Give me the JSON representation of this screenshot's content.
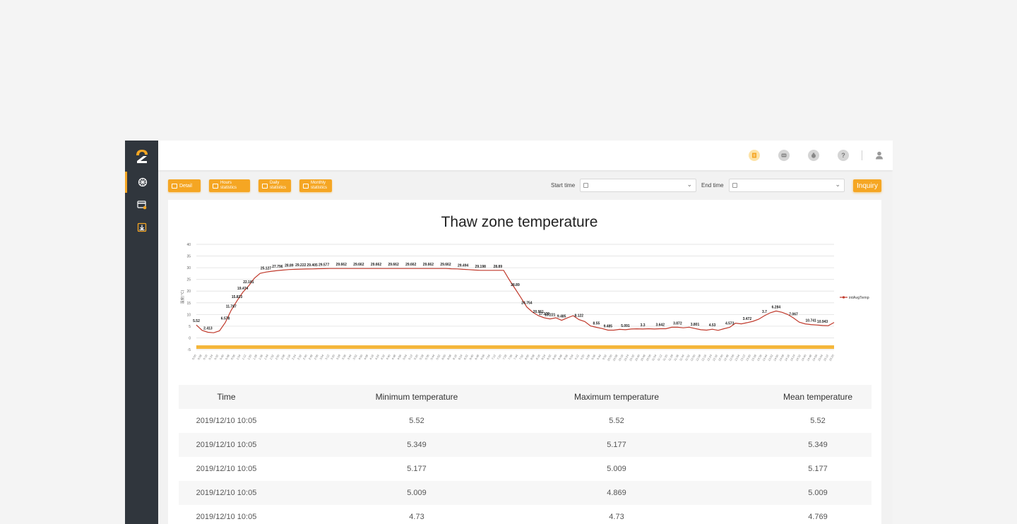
{
  "toolbar": {
    "detail": "Detail",
    "hours": "Hours statistics",
    "daily": "Daily statistics",
    "monthly": "Monthly statistics",
    "start_label": "Start time",
    "end_label": "End time",
    "start_value": "",
    "end_value": "",
    "inquiry": "Inquiry"
  },
  "colors": {
    "accent": "#f5a623",
    "sidebar": "#30363d",
    "line": "#c0392b"
  },
  "sidebar": {
    "items": [
      "dashboard-icon",
      "device-icon",
      "download-icon"
    ]
  },
  "header": {
    "icons": [
      "report-icon",
      "message-icon",
      "money-icon",
      "help-icon",
      "user-icon"
    ]
  },
  "chart_data": {
    "type": "line",
    "title": "Thaw zone temperature",
    "ylabel": "温度(°C)",
    "ylim": [
      -5,
      40
    ],
    "yticks": [
      -5,
      0,
      5,
      10,
      15,
      20,
      25,
      30,
      35,
      40
    ],
    "grid": true,
    "legend_position": "right",
    "series": [
      {
        "name": "intAvgTemp",
        "values": [
          5.52,
          3.2,
          2.413,
          2.2,
          3.0,
          6.578,
          11.787,
          15.823,
          19.474,
          22.181,
          25.5,
          27.6,
          28.127,
          28.5,
          28.8,
          29.0,
          29.222,
          29.3,
          29.405,
          29.45,
          29.5,
          29.577,
          29.6,
          29.662,
          29.662,
          29.662,
          29.662,
          29.662,
          29.662,
          29.662,
          29.662,
          29.662,
          29.662,
          29.662,
          29.662,
          29.662,
          29.662,
          29.662,
          29.662,
          29.662,
          29.662,
          29.662,
          29.662,
          29.662,
          29.55,
          29.494,
          29.3,
          29.198,
          29.0,
          28.89,
          28.89,
          28.89,
          28.89,
          28.89,
          24.754,
          20.961,
          17.139,
          13.221,
          11.0,
          9.485,
          8.6,
          8.122,
          8.6,
          7.5,
          8.55,
          9.485,
          7.8,
          7.0,
          5.091,
          4.5,
          4.0,
          3.3,
          3.3,
          3.642,
          3.5,
          3.8,
          3.872,
          3.8,
          3.9,
          3.801,
          3.9,
          3.9,
          4.53,
          4.55,
          4.3,
          4.573,
          4.0,
          3.472,
          3.3,
          3.7,
          3.2,
          3.9,
          4.5,
          6.284,
          6.0,
          6.5,
          7.067,
          8.0,
          9.5,
          10.741,
          11.5,
          10.943,
          10.0,
          8.5,
          6.721,
          6.0,
          5.7,
          5.52,
          5.3,
          5.2,
          6.593
        ]
      }
    ],
    "data_labels": [
      {
        "i": 0,
        "text": "5.52"
      },
      {
        "i": 2,
        "text": "2.413"
      },
      {
        "i": 5,
        "text": "6.578"
      },
      {
        "i": 6,
        "text": "11.787"
      },
      {
        "i": 7,
        "text": "15.823"
      },
      {
        "i": 8,
        "text": "19.474"
      },
      {
        "i": 9,
        "text": "22.181"
      },
      {
        "i": 12,
        "text": "25.127"
      },
      {
        "i": 14,
        "text": "27.796"
      },
      {
        "i": 16,
        "text": "28.89"
      },
      {
        "i": 18,
        "text": "29.222"
      },
      {
        "i": 20,
        "text": "29.405"
      },
      {
        "i": 22,
        "text": "29.577"
      },
      {
        "i": 25,
        "text": "29.662"
      },
      {
        "i": 28,
        "text": "29.662"
      },
      {
        "i": 31,
        "text": "29.662"
      },
      {
        "i": 34,
        "text": "29.662"
      },
      {
        "i": 37,
        "text": "29.662"
      },
      {
        "i": 40,
        "text": "29.662"
      },
      {
        "i": 43,
        "text": "29.662"
      },
      {
        "i": 46,
        "text": "29.494"
      },
      {
        "i": 49,
        "text": "29.198"
      },
      {
        "i": 52,
        "text": "28.89"
      },
      {
        "i": 55,
        "text": "28.89"
      },
      {
        "i": 57,
        "text": "24.754"
      },
      {
        "i": 59,
        "text": "20.961"
      },
      {
        "i": 60,
        "text": "17.139"
      },
      {
        "i": 61,
        "text": "13.221"
      },
      {
        "i": 63,
        "text": "9.485"
      },
      {
        "i": 66,
        "text": "8.122"
      },
      {
        "i": 69,
        "text": "8.55"
      },
      {
        "i": 71,
        "text": "9.485"
      },
      {
        "i": 74,
        "text": "5.091"
      },
      {
        "i": 77,
        "text": "3.3"
      },
      {
        "i": 80,
        "text": "3.642"
      },
      {
        "i": 83,
        "text": "3.872"
      },
      {
        "i": 86,
        "text": "3.801"
      },
      {
        "i": 89,
        "text": "4.53"
      },
      {
        "i": 92,
        "text": "4.573"
      },
      {
        "i": 95,
        "text": "3.472"
      },
      {
        "i": 98,
        "text": "3.7"
      },
      {
        "i": 100,
        "text": "6.284"
      },
      {
        "i": 103,
        "text": "7.067"
      },
      {
        "i": 106,
        "text": "10.741"
      },
      {
        "i": 108,
        "text": "10.943"
      },
      {
        "i": 111,
        "text": "6.721"
      },
      {
        "i": 114,
        "text": "5.52"
      },
      {
        "i": 116,
        "text": "6.593"
      }
    ],
    "x_tick_labels": [
      "0:00",
      "0:08",
      "0:16",
      "0:24",
      "0:32",
      "0:40",
      "0:48",
      "0:56",
      "1:04",
      "1:12",
      "1:20",
      "1:28",
      "1:36",
      "1:44",
      "1:52",
      "2:00",
      "2:08",
      "2:16",
      "2:24",
      "2:32",
      "2:40",
      "2:48",
      "2:56",
      "3:04",
      "3:12",
      "3:20",
      "3:28",
      "3:36",
      "3:44",
      "3:52",
      "4:00",
      "4:08",
      "4:16",
      "4:24",
      "4:32",
      "4:40",
      "4:48",
      "4:56",
      "5:04",
      "5:12",
      "5:20",
      "5:28",
      "5:36",
      "5:44",
      "5:52",
      "6:00",
      "6:08",
      "6:16",
      "6:24",
      "6:32",
      "6:40",
      "6:48",
      "6:56",
      "7:04",
      "7:12",
      "7:20",
      "7:28",
      "7:36",
      "7:44",
      "7:52",
      "8:00",
      "8:08",
      "8:16",
      "8:24",
      "8:32",
      "8:40",
      "8:48",
      "8:56",
      "9:04",
      "9:12",
      "9:20",
      "9:28",
      "9:36",
      "9:44",
      "9:52",
      "10:00",
      "10:08",
      "10:16",
      "10:24",
      "10:32",
      "10:40",
      "10:48",
      "10:56",
      "11:04",
      "11:12",
      "11:20",
      "11:28",
      "11:36",
      "11:44",
      "11:52",
      "12:00",
      "12:08",
      "12:16",
      "12:24",
      "12:32",
      "12:40",
      "12:48",
      "12:56",
      "13:04",
      "13:12",
      "13:20",
      "13:28",
      "13:36",
      "13:44",
      "13:52",
      "14:00",
      "14:08",
      "14:16",
      "14:24",
      "14:32",
      "14:40",
      "14:48",
      "14:56",
      "15:04",
      "15:12",
      "15:20"
    ]
  },
  "table": {
    "headers": [
      "Time",
      "Minimum temperature",
      "Maximum temperature",
      "Mean temperature"
    ],
    "rows": [
      [
        "2019/12/10 10:05",
        "5.52",
        "5.52",
        "5.52"
      ],
      [
        "2019/12/10 10:05",
        "5.349",
        "5.177",
        "5.349"
      ],
      [
        "2019/12/10 10:05",
        "5.177",
        "5.009",
        "5.177"
      ],
      [
        "2019/12/10 10:05",
        "5.009",
        "4.869",
        "5.009"
      ],
      [
        "2019/12/10 10:05",
        "4.73",
        "4.73",
        "4.769"
      ]
    ]
  }
}
